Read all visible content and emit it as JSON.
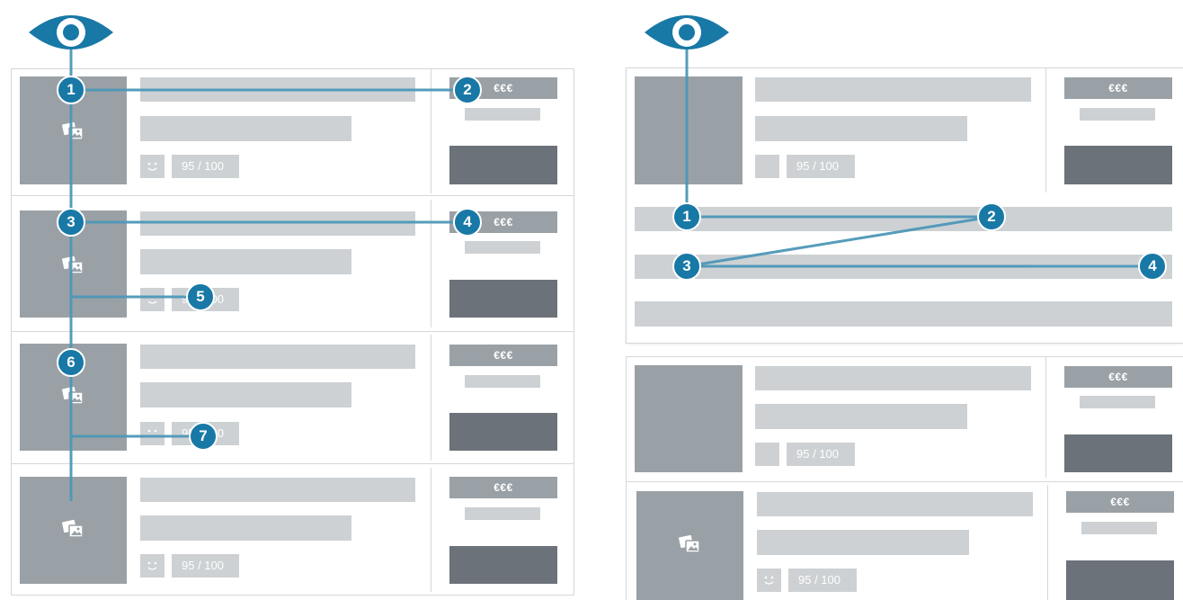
{
  "colors": {
    "accent": "#1878a6",
    "path_line": "#4d97b8",
    "thumbnail": "#9aa1a6",
    "placeholder": "#cdd1d4",
    "button": "#6b7279"
  },
  "icons": {
    "viewer": "eye-icon",
    "image": "image-gallery-icon",
    "rating": "smiley-icon"
  },
  "left": {
    "listings": [
      {
        "price": "€€€",
        "score": "95 / 100"
      },
      {
        "price": "€€€",
        "score": "95 / 100"
      },
      {
        "price": "€€€",
        "score": "95 / 100"
      },
      {
        "price": "€€€",
        "score": "95 / 100"
      }
    ],
    "fixations": [
      "1",
      "2",
      "3",
      "4",
      "5",
      "6",
      "7"
    ]
  },
  "right": {
    "expanded_listing": {
      "price": "€€€",
      "score": "95 / 100"
    },
    "listings": [
      {
        "price": "€€€",
        "score": "95 / 100"
      },
      {
        "price": "€€€",
        "score": "95 / 100"
      }
    ],
    "fixations": [
      "1",
      "2",
      "3",
      "4"
    ]
  }
}
